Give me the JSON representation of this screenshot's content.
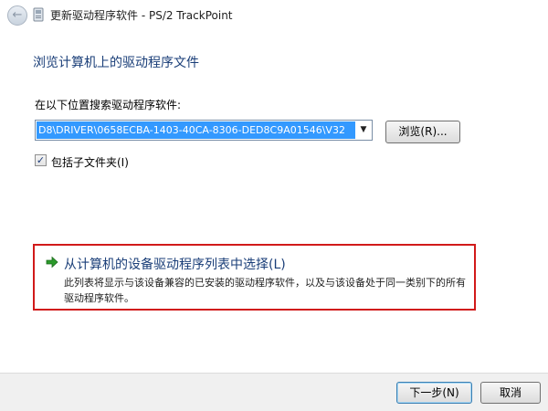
{
  "window": {
    "title": "更新驱动程序软件 - PS/2 TrackPoint",
    "back_icon": "back-arrow-icon",
    "app_icon": "device-icon"
  },
  "heading": "浏览计算机上的驱动程序文件",
  "search": {
    "label": "在以下位置搜索驱动程序软件:",
    "path_value": "D8\\DRIVER\\0658ECBA-1403-40CA-8306-DED8C9A01546\\V32",
    "dropdown_icon": "chevron-down-icon",
    "browse_label": "浏览(R)...",
    "include_subfolders_label": "包括子文件夹(I)",
    "include_subfolders_checked": true
  },
  "pick_option": {
    "title": "从计算机的设备驱动程序列表中选择(L)",
    "description": "此列表将显示与该设备兼容的已安装的驱动程序软件，以及与该设备处于同一类别下的所有驱动程序软件。",
    "icon": "green-arrow-icon",
    "highlight_color": "#d11a1a"
  },
  "footer": {
    "next_label": "下一步(N)",
    "cancel_label": "取消"
  },
  "colors": {
    "accent": "#1a3e78",
    "selection": "#3399ff"
  }
}
